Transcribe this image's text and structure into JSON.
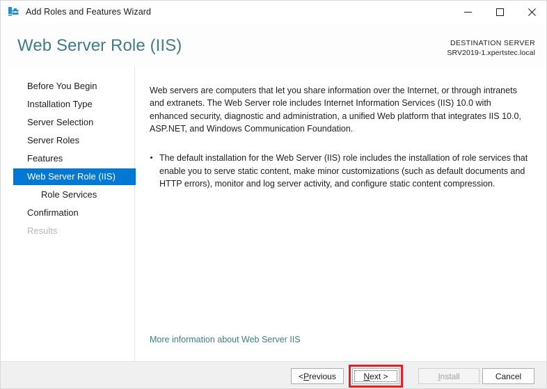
{
  "titlebar": {
    "title": "Add Roles and Features Wizard",
    "icon": "roles-features-wizard-icon",
    "minimize_label": "Minimize",
    "maximize_label": "Maximize",
    "close_label": "Close"
  },
  "header": {
    "page_title": "Web Server Role (IIS)",
    "destination_label": "DESTINATION SERVER",
    "destination_value": "SRV2019-1.xpertstec.local",
    "title_color": "#3f7d84"
  },
  "nav": {
    "items": [
      {
        "label": "Before You Begin",
        "state": "normal",
        "indent": false
      },
      {
        "label": "Installation Type",
        "state": "normal",
        "indent": false
      },
      {
        "label": "Server Selection",
        "state": "normal",
        "indent": false
      },
      {
        "label": "Server Roles",
        "state": "normal",
        "indent": false
      },
      {
        "label": "Features",
        "state": "normal",
        "indent": false
      },
      {
        "label": "Web Server Role (IIS)",
        "state": "selected",
        "indent": false
      },
      {
        "label": "Role Services",
        "state": "normal",
        "indent": true
      },
      {
        "label": "Confirmation",
        "state": "normal",
        "indent": false
      },
      {
        "label": "Results",
        "state": "disabled",
        "indent": false
      }
    ],
    "selected_color": "#0078d4",
    "disabled_color": "#b6b6b6"
  },
  "content": {
    "intro": "Web servers are computers that let you share information over the Internet, or through intranets and extranets. The Web Server role includes Internet Information Services (IIS) 10.0 with enhanced security, diagnostic and administration, a unified Web platform that integrates IIS 10.0, ASP.NET, and Windows Communication Foundation.",
    "bullets": [
      "The default installation for the Web Server (IIS) role includes the installation of role services that enable you to serve static content, make minor customizations (such as default documents and HTTP errors), monitor and log server activity, and configure static content compression."
    ],
    "more_link": "More information about Web Server IIS"
  },
  "footer": {
    "previous": {
      "prefix": "< ",
      "accel": "P",
      "rest": "revious",
      "disabled": false
    },
    "next": {
      "prefix": "",
      "accel": "N",
      "rest": "ext >",
      "disabled": false,
      "focused": true
    },
    "install": {
      "prefix": "",
      "accel": "I",
      "rest": "nstall",
      "disabled": true
    },
    "cancel": {
      "label": "Cancel",
      "disabled": false
    }
  },
  "annotation": {
    "target": "next-button",
    "color": "#ec1c24"
  }
}
